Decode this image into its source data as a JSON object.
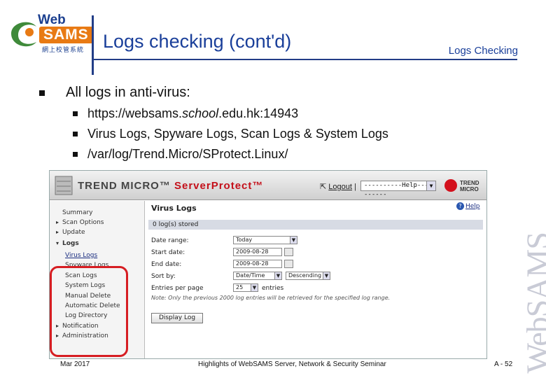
{
  "header": {
    "logo": {
      "line1": "Web",
      "line2": "SAMS",
      "line3": "網上校管系統"
    },
    "title": "Logs checking (cont'd)",
    "section": "Logs Checking"
  },
  "bullets": {
    "main": "All logs in anti-virus:",
    "sub": [
      {
        "pre": "https://websams.",
        "em": "school",
        "post": ".edu.hk:14943"
      },
      {
        "text": "Virus Logs, Spyware Logs, Scan Logs & System Logs"
      },
      {
        "text": "/var/log/Trend.Micro/SProtect.Linux/"
      }
    ]
  },
  "screenshot": {
    "brand": "TREND MICRO™",
    "product": "ServerProtect™",
    "logout": "Logout",
    "help_select": "----------Help----------",
    "vendor_logo": {
      "line1": "TREND",
      "line2": "MICRO"
    },
    "nav": [
      {
        "label": "Summary",
        "caret": ""
      },
      {
        "label": "Scan Options",
        "caret": "▸"
      },
      {
        "label": "Update",
        "caret": "▸"
      },
      {
        "label": "Logs",
        "caret": "▾"
      },
      {
        "label": "Virus Logs",
        "caret": "",
        "sub": true,
        "selected": true
      },
      {
        "label": "Spyware Logs",
        "caret": "",
        "sub": true
      },
      {
        "label": "Scan Logs",
        "caret": "",
        "sub": true
      },
      {
        "label": "System Logs",
        "caret": "",
        "sub": true
      },
      {
        "label": "Manual Delete",
        "caret": "",
        "sub": true
      },
      {
        "label": "Automatic Delete",
        "caret": "",
        "sub": true
      },
      {
        "label": "Log Directory",
        "caret": "",
        "sub": true
      },
      {
        "label": "Notification",
        "caret": "▸"
      },
      {
        "label": "Administration",
        "caret": "▸"
      }
    ],
    "page_title": "Virus Logs",
    "help_link": "Help",
    "stored": "0 log(s) stored",
    "form": {
      "date_range_label": "Date range:",
      "date_range_value": "Today",
      "start_label": "Start date:",
      "start_value": "2009-08-28",
      "end_label": "End date:",
      "end_value": "2009-08-28",
      "sort_label": "Sort by:",
      "sort_value": "Date/Time",
      "sort_order": "Descending",
      "entries_label": "Entries per page",
      "entries_value": "25",
      "entries_unit": "entries"
    },
    "note": "Note: Only the previous 2000 log entries will be retrieved for the specified log range.",
    "display_button": "Display Log"
  },
  "footer": {
    "date": "Mar 2017",
    "center": "Highlights of WebSAMS Server, Network & Security Seminar",
    "page": "A - 52",
    "watermark": "WebSAMS"
  }
}
